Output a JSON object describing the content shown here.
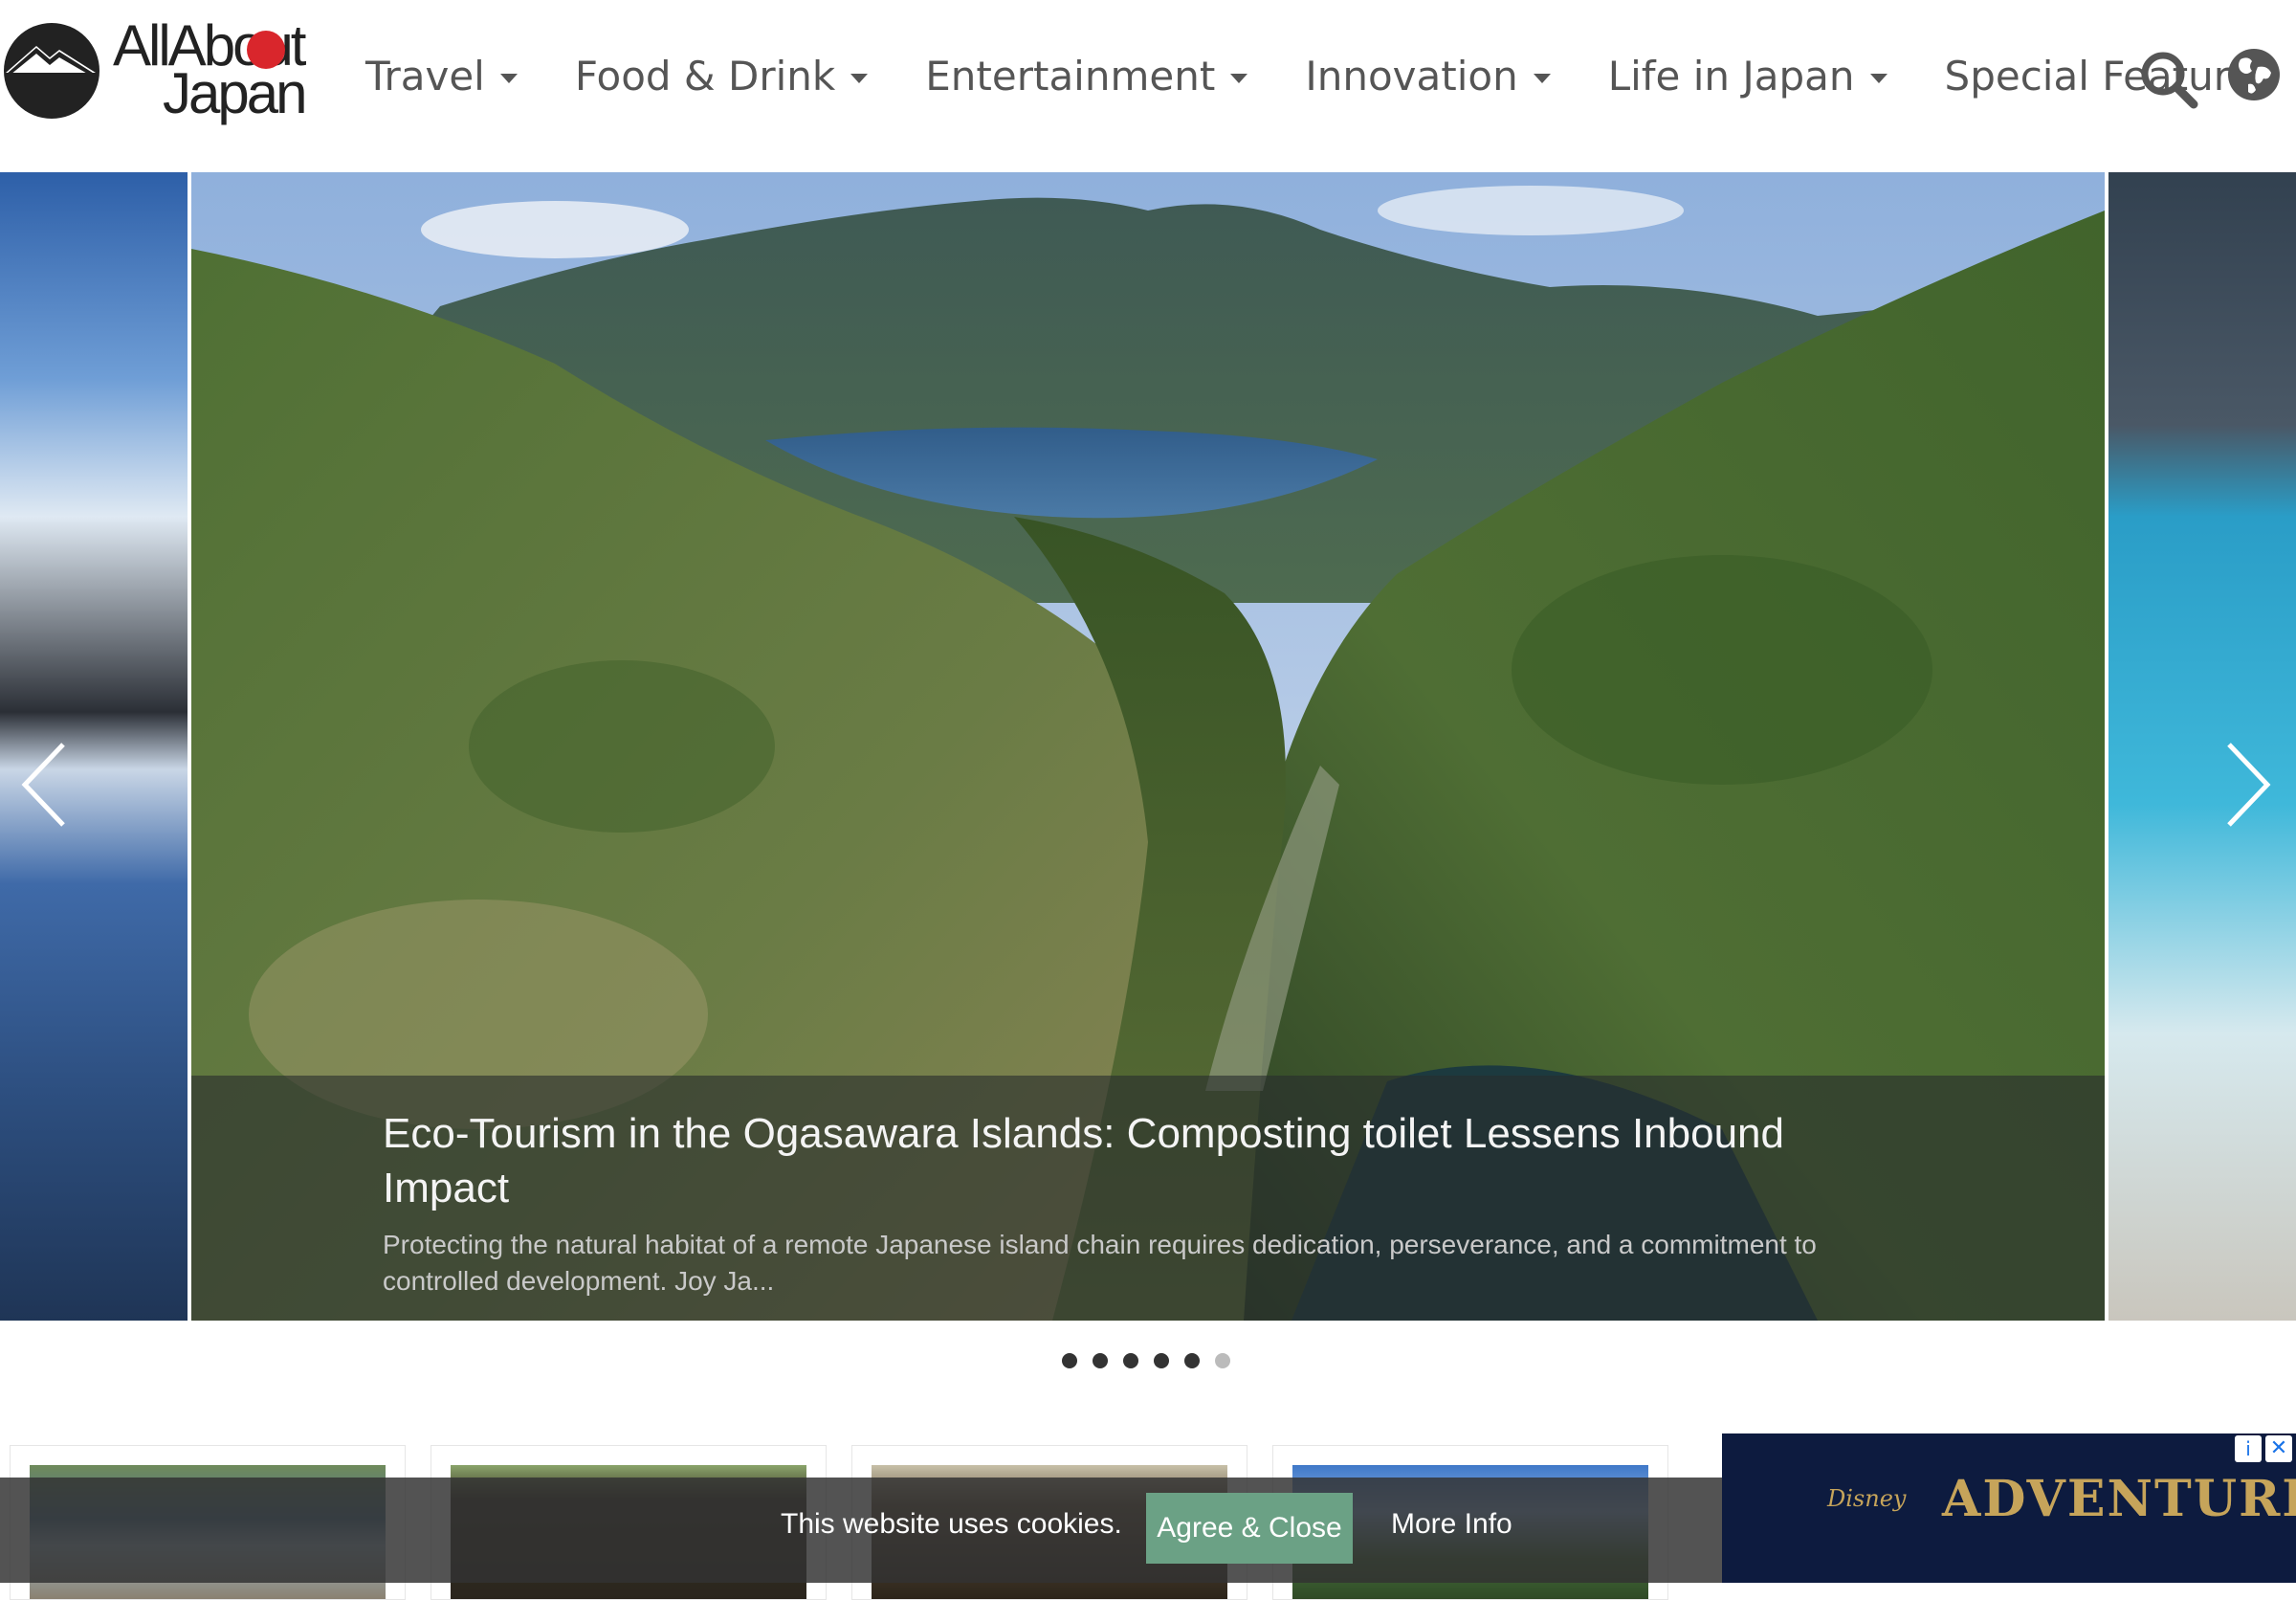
{
  "logo": {
    "line1": "AllAbout",
    "line2": "Japan"
  },
  "nav": {
    "items": [
      {
        "label": "Travel",
        "has_dropdown": true
      },
      {
        "label": "Food & Drink",
        "has_dropdown": true
      },
      {
        "label": "Entertainment",
        "has_dropdown": true
      },
      {
        "label": "Innovation",
        "has_dropdown": true
      },
      {
        "label": "Life in Japan",
        "has_dropdown": true
      },
      {
        "label": "Special Feature",
        "has_dropdown": false
      }
    ],
    "icons": [
      "search-icon",
      "globe-icon"
    ]
  },
  "carousel": {
    "current_slide": {
      "title": "Eco-Tourism in the Ogasawara Islands: Composting toilet Lessens Inbound Impact",
      "description": "Protecting the natural habitat of a remote Japanese island chain requires dedication, perseverance, and a commitment to controlled development. Joy Ja..."
    },
    "dot_count": 6,
    "active_dot": 6
  },
  "ad": {
    "brand": "Disney",
    "text": "ADVENTURE"
  },
  "cookie": {
    "message": "This website uses cookies.",
    "agree_label": "Agree & Close",
    "more_label": "More Info"
  },
  "colors": {
    "accent_red": "#d9262c",
    "agree_button": "#6ba185",
    "nav_text": "#555555"
  }
}
